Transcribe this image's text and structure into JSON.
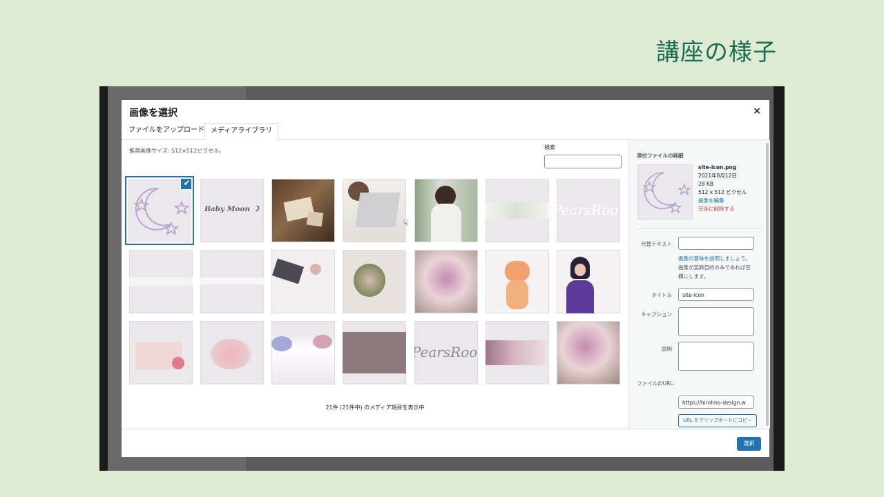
{
  "slide_title": "講座の様子",
  "modal": {
    "title": "画像を選択",
    "close_label": "×",
    "tabs": [
      "ファイルをアップロード",
      "メディアライブラリ"
    ],
    "hint": "推奨画像サイズ: 512×512ピクセル。",
    "search_label": "検索",
    "search_value": "",
    "thumb_texts": [
      "Baby Moon ☽",
      "PearsRoo",
      "PearsRoo"
    ],
    "check_mark": "✔",
    "count_text": "21件 (21件中) のメディア項目を表示中",
    "select_label": "選択"
  },
  "sidebar": {
    "heading": "添付ファイルの詳細",
    "file_name": "site-icon.png",
    "date": "2021年8月12日",
    "size": "28 KB",
    "dims": "512 x 512 ピクセル",
    "edit_link": "画像を編集",
    "delete_link": "完全に削除する",
    "alt_label": "代替テキスト",
    "alt_value": "",
    "alt_help_link": "画像の意味を説明しましょう",
    "alt_help_text": "。画像が装飾目的のみであれば空欄にします。",
    "title_label": "タイトル",
    "title_value": "site-icon",
    "caption_label": "キャプション",
    "caption_value": "",
    "desc_label": "説明",
    "desc_value": "",
    "url_label": "ファイルのURL:",
    "url_value": "https://hirohiro-design.w",
    "copy_label": "URL をクリップボードにコピー"
  },
  "colors": {
    "accent": "#2271b1",
    "danger": "#d63638",
    "slide_bg": "#dcebd2",
    "title_green": "#1d6b57"
  }
}
